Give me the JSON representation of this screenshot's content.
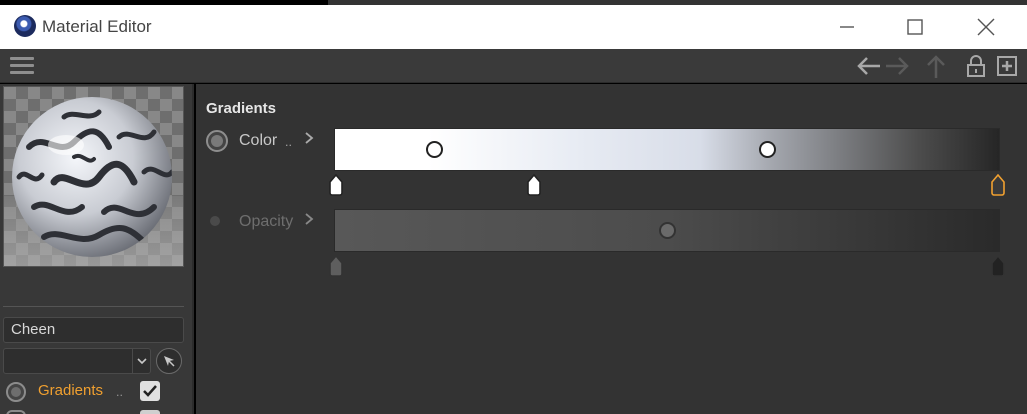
{
  "window": {
    "title": "Material Editor",
    "controls": [
      "minimize-icon",
      "maximize-icon",
      "close-icon"
    ]
  },
  "toolbar": {
    "icons": [
      "menu-icon",
      "back-arrow-icon",
      "forward-arrow-icon",
      "up-arrow-icon",
      "lock-icon",
      "new-window-icon"
    ]
  },
  "left_panel": {
    "material_name": "Cheen",
    "dropdown_value": "",
    "channels": [
      {
        "label": "Gradients",
        "dots": "..",
        "checked": true,
        "color": "#f0a030"
      }
    ]
  },
  "main": {
    "section_title": "Gradients",
    "params": [
      {
        "label": "Color",
        "dots": "..",
        "enabled": true,
        "label_color": "#c8c8c8",
        "stops": [
          0.0,
          0.3,
          1.0
        ],
        "selected_stop": 2,
        "interpolation_knobs": [
          0.15,
          0.65
        ]
      },
      {
        "label": "Opacity",
        "dots": "",
        "enabled": false,
        "label_color": "#6e6e6e",
        "stops": [
          0.0,
          1.0
        ],
        "interpolation_knobs": [
          0.5
        ]
      }
    ]
  },
  "colors": {
    "accent": "#f0a030",
    "panel_bg": "#333333",
    "sidebar_bg": "#383838",
    "titlebar_bg": "#ffffff"
  }
}
